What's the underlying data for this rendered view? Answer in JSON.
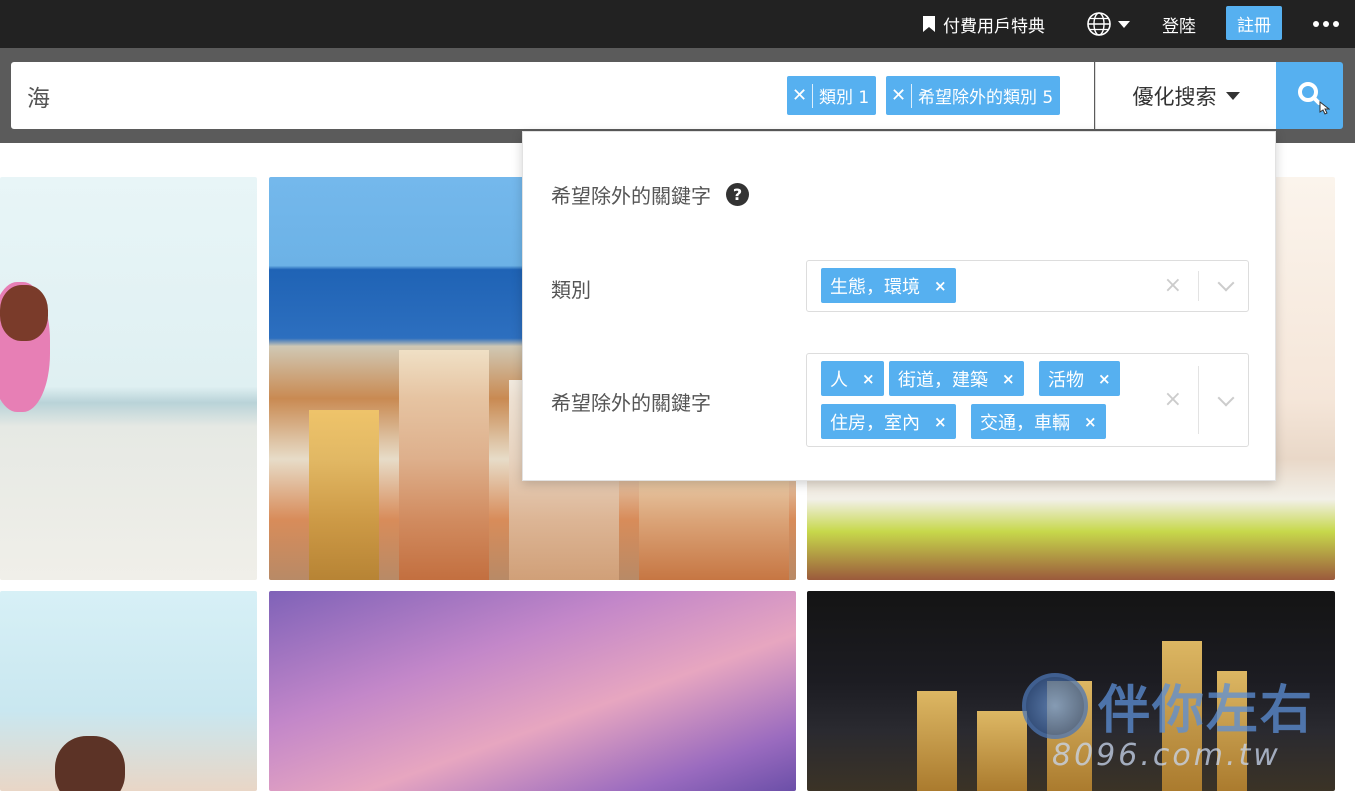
{
  "nav": {
    "premium": "付費用戶特典",
    "login": "登陸",
    "register": "註冊"
  },
  "search": {
    "query": "海",
    "chips": [
      "類別 1",
      "希望除外的類別 5"
    ],
    "optimize": "優化搜索"
  },
  "panel": {
    "title": "希望除外的關鍵字",
    "category_label": "類別",
    "category_tags": [
      "生態，環境"
    ],
    "keyword_label": "希望除外的關鍵字",
    "keyword_tags": [
      "人",
      "街道，建築",
      "活物",
      "住房，室內",
      "交通，車輛"
    ]
  },
  "watermark": {
    "text": "伴你左右",
    "url": "8096.com.tw"
  },
  "colors": {
    "accent": "#56b0f0",
    "topbar": "#222222",
    "searchband": "#5b5b5b"
  }
}
